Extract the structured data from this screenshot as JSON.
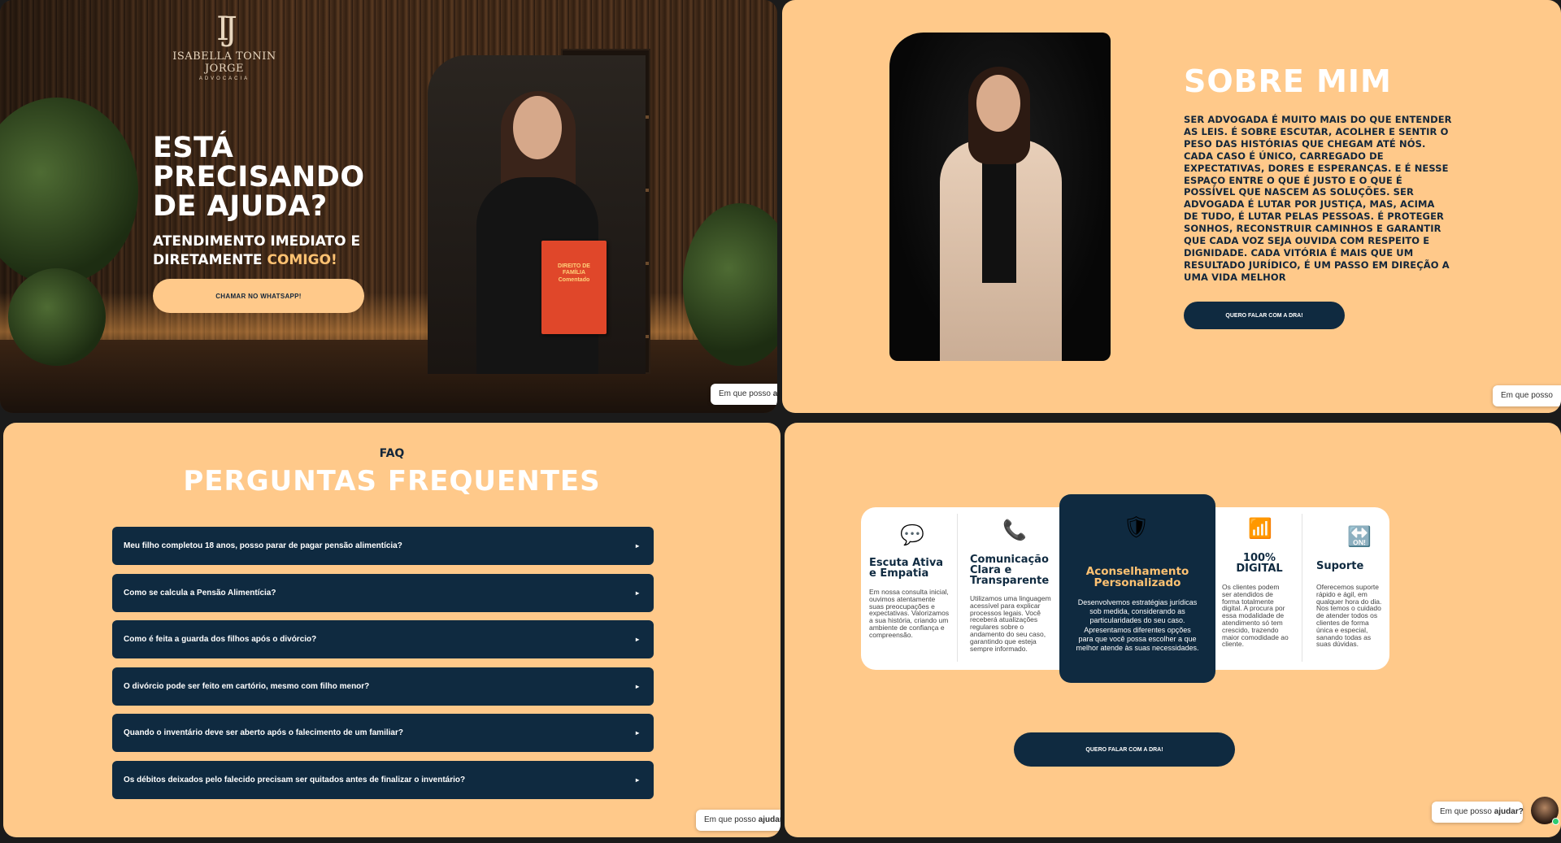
{
  "hero": {
    "logo_mark": "IJ",
    "logo_name": "ISABELLA TONIN JORGE",
    "logo_sub": "ADVOCACIA",
    "title_line1": "ESTÁ",
    "title_line2": "PRECISANDO",
    "title_line3": "DE AJUDA?",
    "subtitle_line1": "ATENDIMENTO IMEDIATO E",
    "subtitle_line2": "DIRETAMENTE ",
    "subtitle_accent": "COMIGO!",
    "cta": "CHAMAR NO WHATSAPP!",
    "book_title": "DIREITO DE FAMÍLIA Comentado",
    "chat_text": "Em que posso ",
    "chat_bold": "aju"
  },
  "about": {
    "title": "SOBRE MIM",
    "text": "SER ADVOGADA É MUITO MAIS DO QUE ENTENDER AS LEIS. É SOBRE ESCUTAR, ACOLHER E SENTIR O PESO DAS HISTÓRIAS QUE CHEGAM ATÉ NÓS. CADA CASO É ÚNICO, CARREGADO DE EXPECTATIVAS, DORES E ESPERANÇAS. E É NESSE ESPAÇO ENTRE O QUE É JUSTO E O QUE É POSSÍVEL QUE NASCEM AS SOLUÇÕES. SER ADVOGADA É LUTAR POR JUSTIÇA, MAS, ACIMA DE TUDO, É LUTAR PELAS PESSOAS. É PROTEGER SONHOS, RECONSTRUIR CAMINHOS E GARANTIR QUE CADA VOZ SEJA OUVIDA COM RESPEITO E DIGNIDADE. CADA VITÓRIA É MAIS QUE UM RESULTADO JURÍDICO, É UM PASSO EM DIREÇÃO A UMA VIDA MELHOR",
    "cta": "QUERO FALAR COM A DRA!",
    "chat_text": "Em que posso"
  },
  "faq": {
    "tag": "FAQ",
    "title": "PERGUNTAS FREQUENTES",
    "items": [
      {
        "q": "Meu filho completou 18 anos, posso parar de pagar pensão alimentícia?"
      },
      {
        "q": "Como se calcula a Pensão Alimentícia?"
      },
      {
        "q": "Como é feita a guarda dos filhos após o divórcio?"
      },
      {
        "q": "O divórcio pode ser feito em cartório, mesmo com filho menor?"
      },
      {
        "q": "Quando o inventário deve ser aberto após o falecimento de um familiar?"
      },
      {
        "q": "Os débitos deixados pelo falecido precisam ser quitados antes de finalizar o inventário?"
      }
    ],
    "caret": "▸",
    "chat_text": "Em que posso ",
    "chat_bold": "ajudar?"
  },
  "services": {
    "cards": [
      {
        "icon": "speech-bubble-icon",
        "glyph": "💬",
        "title": "Escuta Ativa e Empatia",
        "text": "Em nossa consulta inicial, ouvimos atentamente suas preocupações e expectativas. Valorizamos a sua história, criando um ambiente de confiança e compreensão."
      },
      {
        "icon": "phone-icon",
        "glyph": "📞",
        "title": "Comunicação Clara e Transparente",
        "text": "Utilizamos uma linguagem acessível para explicar processos legais. Você receberá atualizações regulares sobre o andamento do seu caso, garantindo que esteja sempre informado."
      },
      {
        "icon": "shield-icon",
        "glyph": "🛡",
        "title": "Aconselhamento Personalizado",
        "text": "Desenvolvemos estratégias jurídicas sob medida, considerando as particularidades do seu caso. Apresentamos diferentes opções para que você possa escolher a que melhor atende às suas necessidades."
      },
      {
        "icon": "wifi-icon",
        "glyph": "📶",
        "title": "100% DIGITAL",
        "text": "Os clientes podem ser atendidos de forma totalmente digital. A procura por essa modalidade de atendimento só tem crescido, trazendo maior comodidade ao cliente."
      },
      {
        "icon": "toggle-icon",
        "glyph": "🔛",
        "title": "Suporte",
        "text": "Oferecemos suporte rápido e ágil, em qualquer hora do dia. Nos temos o cuidado de atender todos os clientes de forma única e especial, sanando todas as suas dúvidas."
      }
    ],
    "cta": "QUERO FALAR COM A DRA!",
    "chat_text": "Em que posso ",
    "chat_bold": "ajudar?"
  },
  "colors": {
    "peach": "#ffc98a",
    "navy": "#0f2a40",
    "accent": "#ffc272"
  }
}
